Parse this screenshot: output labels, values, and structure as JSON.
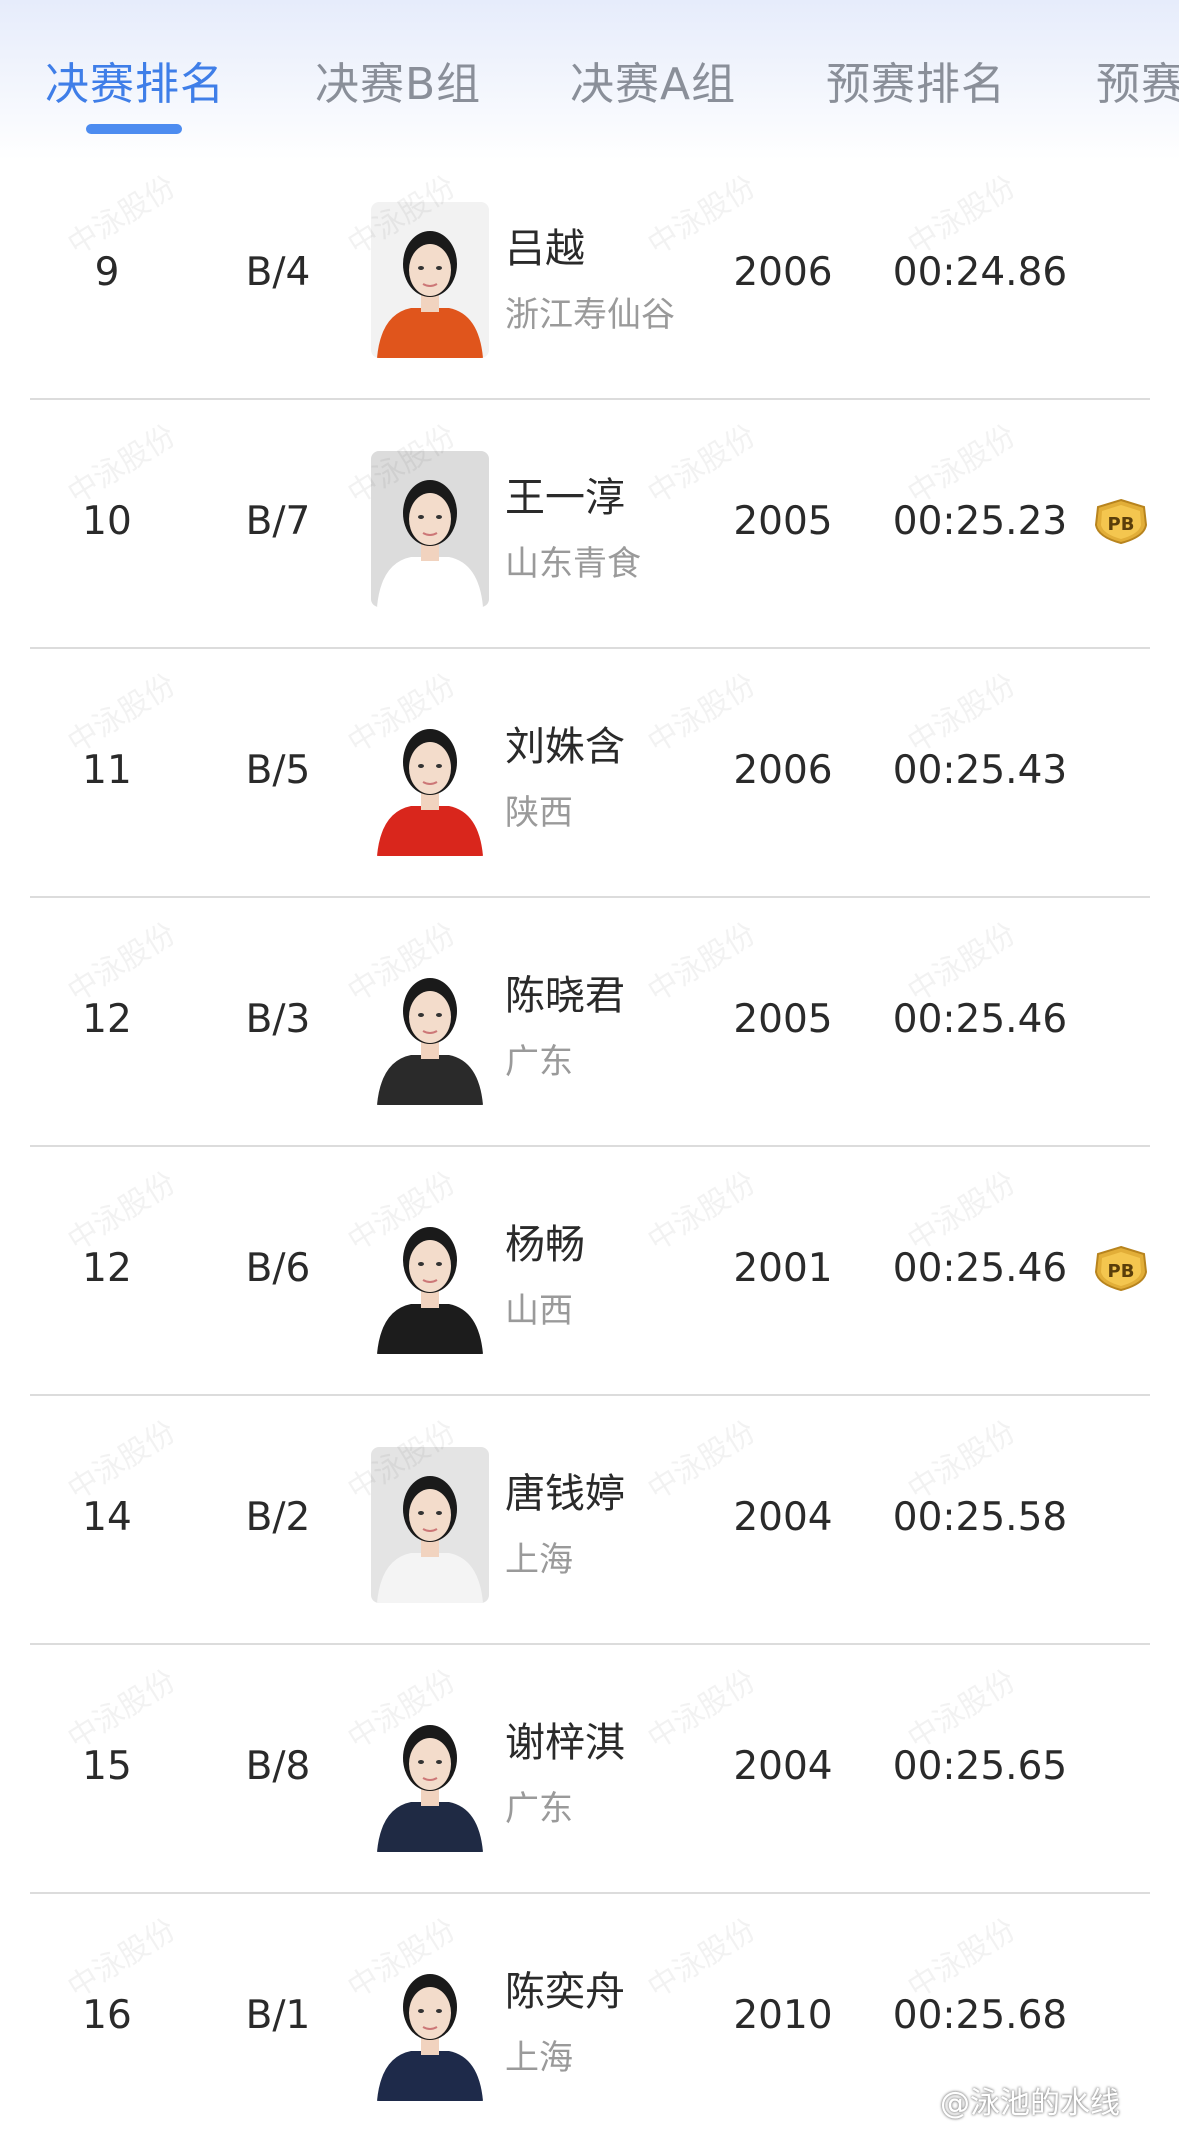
{
  "tabs": [
    {
      "label": "决赛排名",
      "active": true
    },
    {
      "label": "决赛B组",
      "active": false
    },
    {
      "label": "决赛A组",
      "active": false
    },
    {
      "label": "预赛排名",
      "active": false
    },
    {
      "label": "预赛",
      "active": false
    }
  ],
  "watermark_text": "中泳股份",
  "pb_label": "PB",
  "colors": {
    "active_tab": "#3f7ee8",
    "inactive_tab": "#8a8f99",
    "text": "#2a2a2a",
    "team_text": "#9a9a9a",
    "pb_badge": "#e2ae38"
  },
  "rows": [
    {
      "rank": "9",
      "lane": "B/4",
      "name": "吕越",
      "team": "浙江寿仙谷",
      "year": "2006",
      "time": "00:24.86",
      "pb": false
    },
    {
      "rank": "10",
      "lane": "B/7",
      "name": "王一淳",
      "team": "山东青食",
      "year": "2005",
      "time": "00:25.23",
      "pb": true
    },
    {
      "rank": "11",
      "lane": "B/5",
      "name": "刘姝含",
      "team": "陕西",
      "year": "2006",
      "time": "00:25.43",
      "pb": false
    },
    {
      "rank": "12",
      "lane": "B/3",
      "name": "陈晓君",
      "team": "广东",
      "year": "2005",
      "time": "00:25.46",
      "pb": false
    },
    {
      "rank": "12",
      "lane": "B/6",
      "name": "杨畅",
      "team": "山西",
      "year": "2001",
      "time": "00:25.46",
      "pb": true
    },
    {
      "rank": "14",
      "lane": "B/2",
      "name": "唐钱婷",
      "team": "上海",
      "year": "2004",
      "time": "00:25.58",
      "pb": false
    },
    {
      "rank": "15",
      "lane": "B/8",
      "name": "谢梓淇",
      "team": "广东",
      "year": "2004",
      "time": "00:25.65",
      "pb": false
    },
    {
      "rank": "16",
      "lane": "B/1",
      "name": "陈奕舟",
      "team": "上海",
      "year": "2010",
      "time": "00:25.68",
      "pb": false
    }
  ],
  "photo_styles": [
    {
      "bg": "#f2f2f2",
      "shirt": "#e0551c",
      "hair": "#1a1a1a"
    },
    {
      "bg": "#dcdcdc",
      "shirt": "#ffffff",
      "hair": "#1a1a1a"
    },
    {
      "bg": "#ffffff",
      "shirt": "#d9261c",
      "hair": "#1a1a1a"
    },
    {
      "bg": "#ffffff",
      "shirt": "#2a2a2a",
      "hair": "#1a1a1a"
    },
    {
      "bg": "#ffffff",
      "shirt": "#1c1c1c",
      "hair": "#1a1a1a"
    },
    {
      "bg": "#e4e4e4",
      "shirt": "#f4f4f4",
      "hair": "#1a1a1a"
    },
    {
      "bg": "#ffffff",
      "shirt": "#1f2a44",
      "hair": "#1a1a1a"
    },
    {
      "bg": "#ffffff",
      "shirt": "#1e2a4a",
      "hair": "#1a1a1a"
    }
  ],
  "credit": "@泳池的水线"
}
